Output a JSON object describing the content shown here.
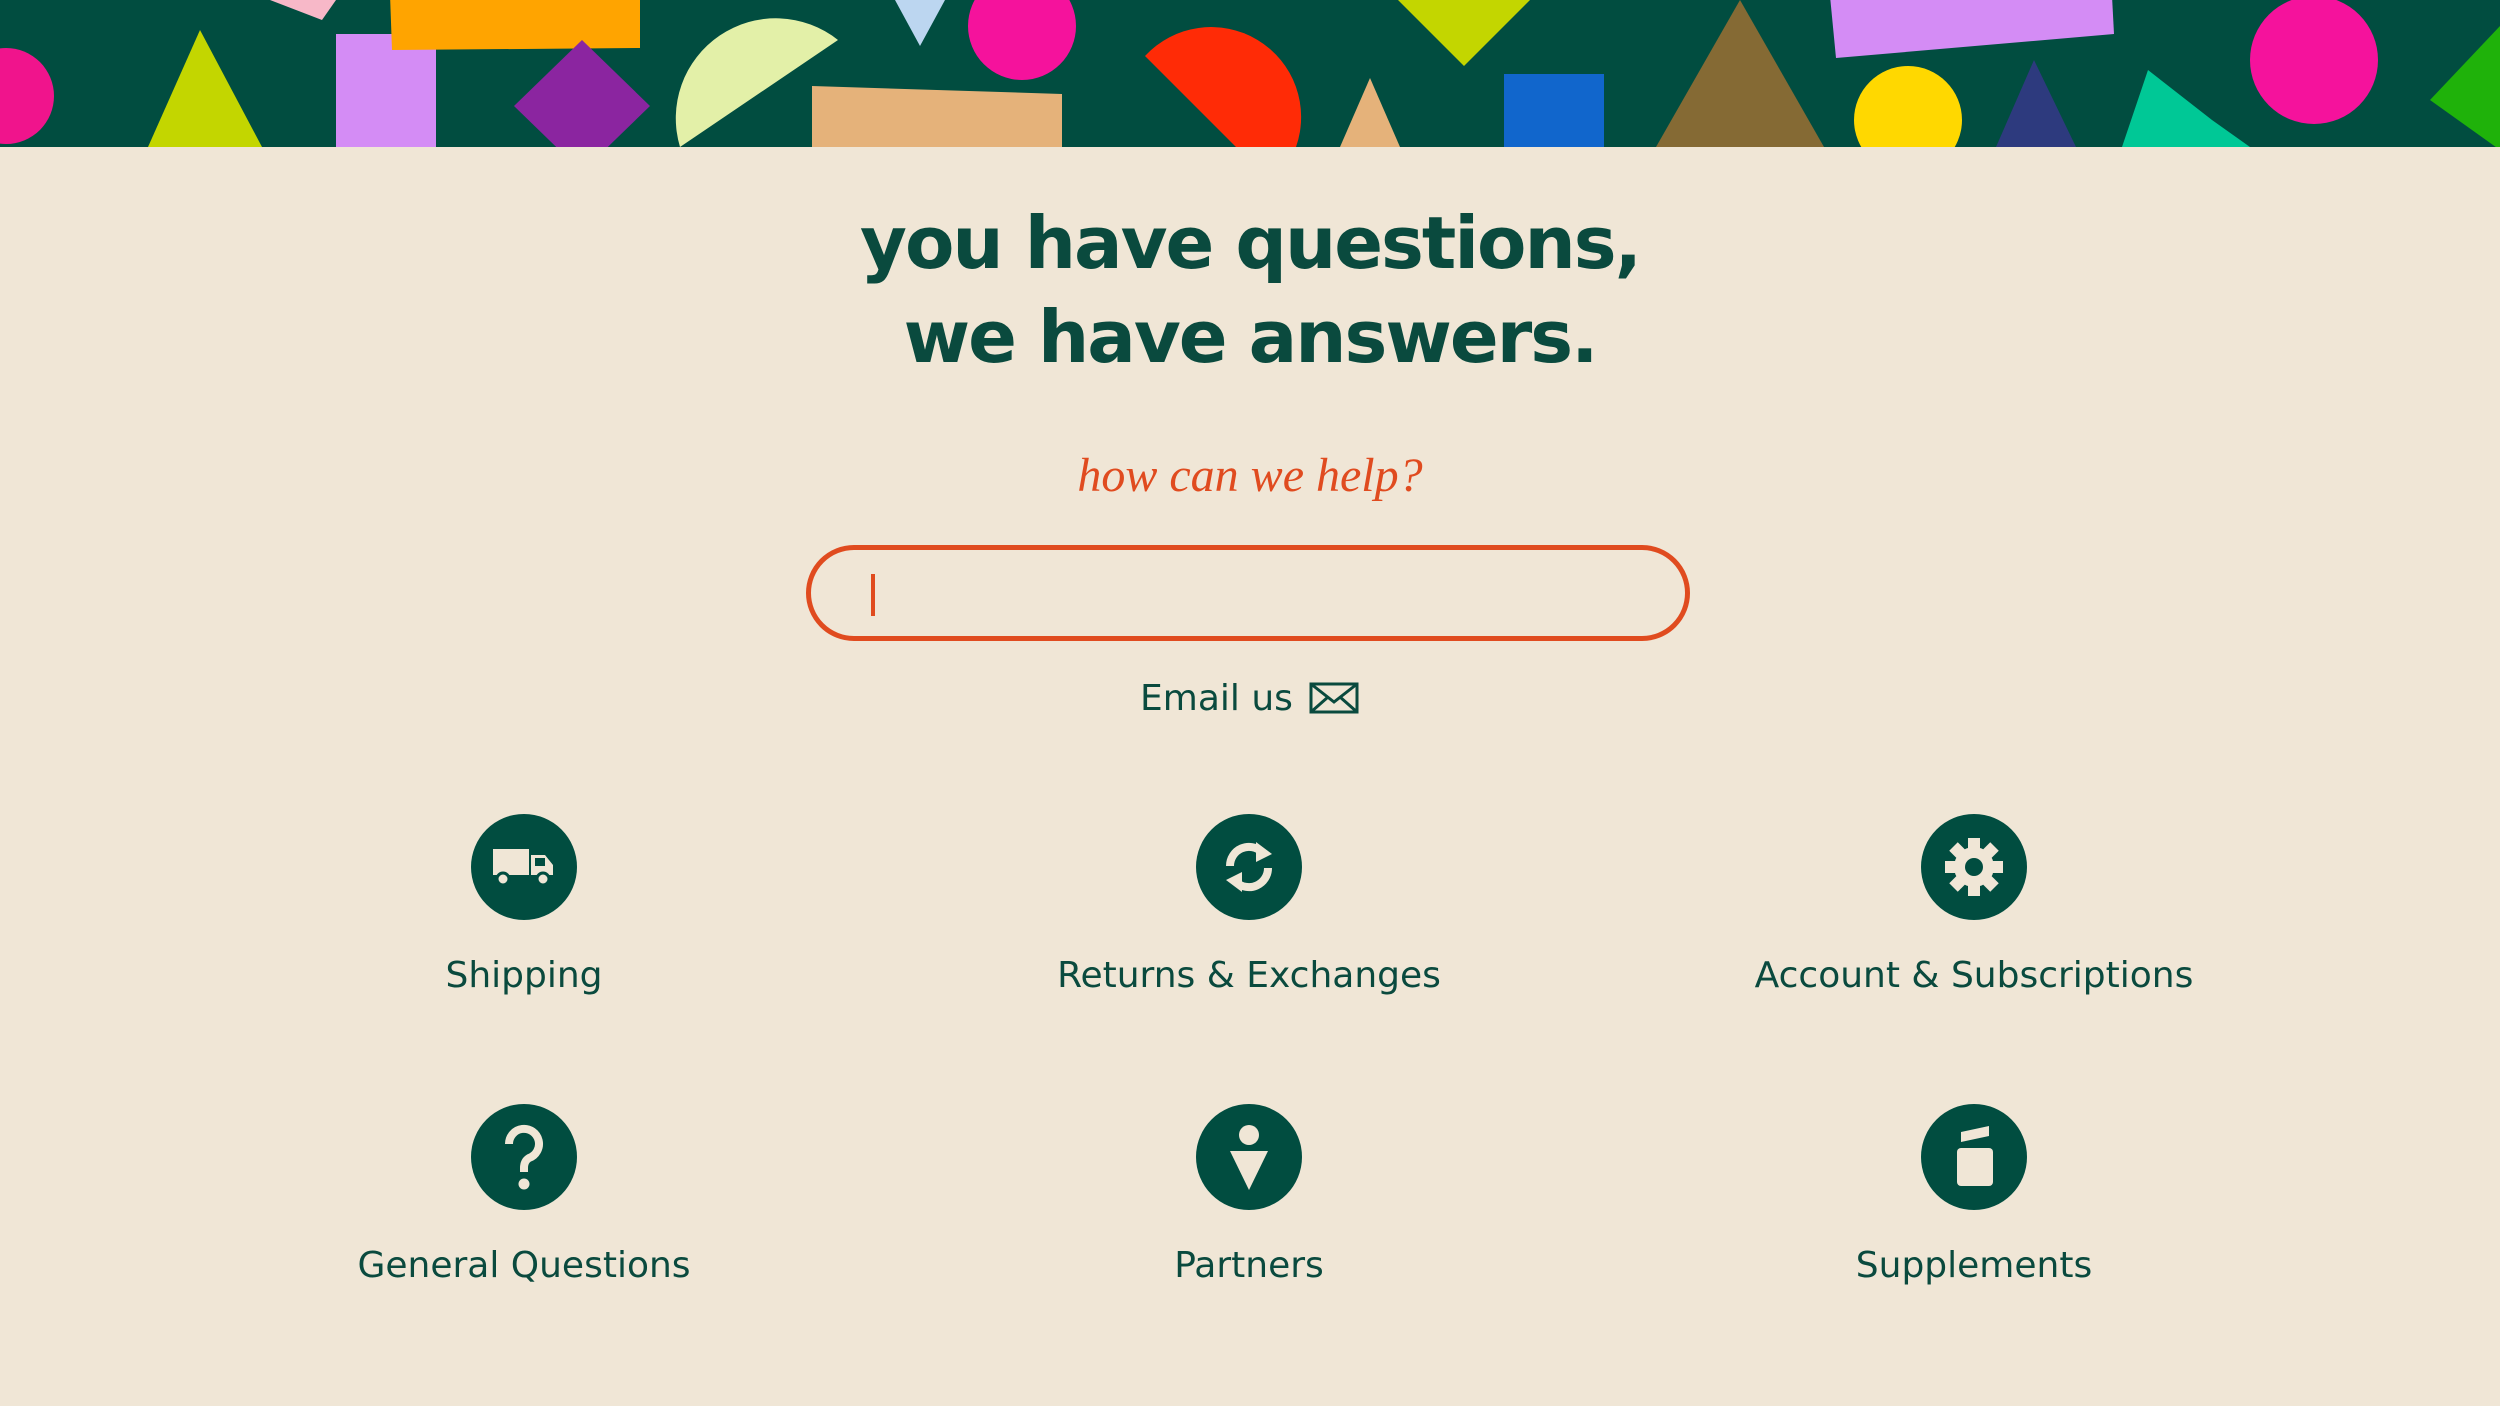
{
  "colors": {
    "background": "#F0E6D6",
    "banner": "#014D40",
    "heading": "#0A4A3E",
    "accent": "#E04B1F"
  },
  "hero": {
    "title_line1": "you have questions,",
    "title_line2": "we have answers."
  },
  "search": {
    "prompt": "how can we help?",
    "value": "",
    "placeholder": ""
  },
  "contact": {
    "email_label": "Email us",
    "icon": "envelope-icon"
  },
  "categories": [
    {
      "label": "Shipping",
      "icon": "truck-icon"
    },
    {
      "label": "Returns & Exchanges",
      "icon": "exchange-arrows-icon"
    },
    {
      "label": "Account & Subscriptions",
      "icon": "gear-icon"
    },
    {
      "label": "General Questions",
      "icon": "question-mark-icon"
    },
    {
      "label": "Partners",
      "icon": "person-icon"
    },
    {
      "label": "Supplements",
      "icon": "supplement-jar-icon"
    }
  ]
}
